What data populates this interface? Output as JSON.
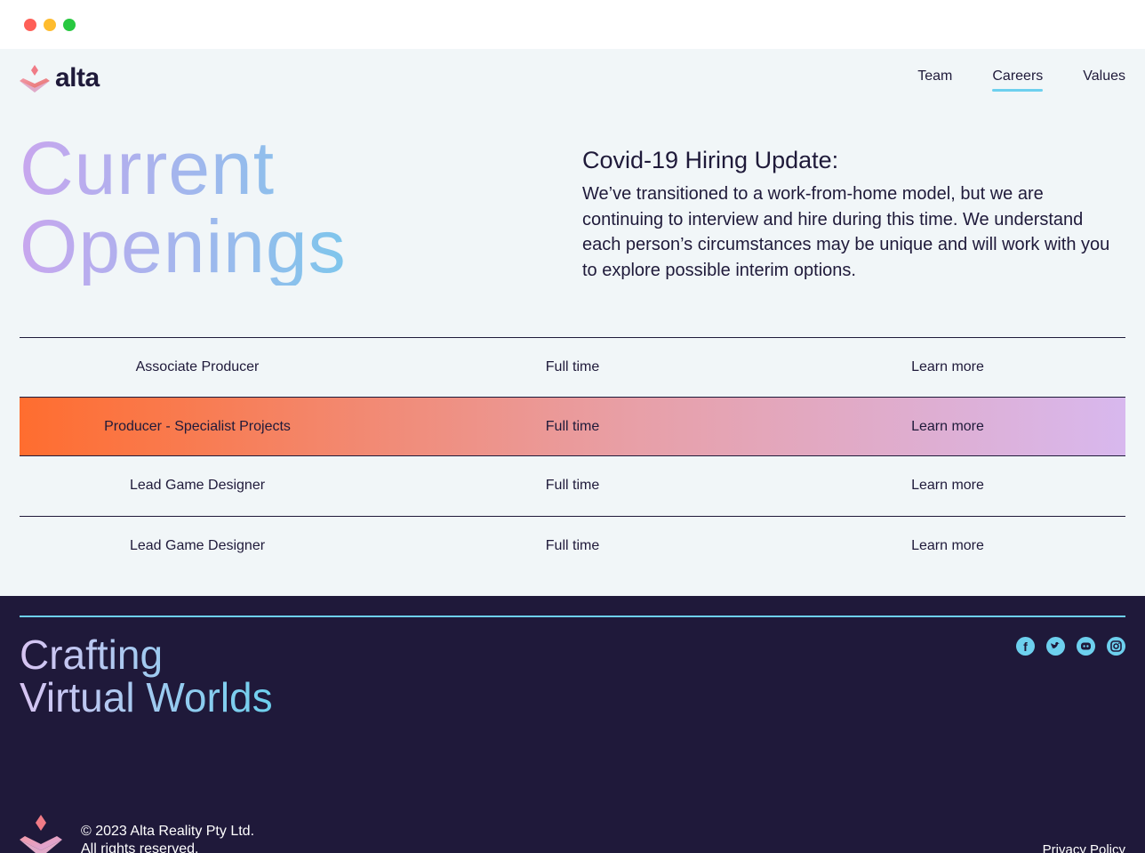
{
  "brand": {
    "name": "alta",
    "accent": "#6dd0ee",
    "dark": "#1f193a"
  },
  "nav": {
    "items": [
      {
        "label": "Team"
      },
      {
        "label": "Careers"
      },
      {
        "label": "Values"
      }
    ],
    "active": "Careers"
  },
  "hero": {
    "title_line1": "Current",
    "title_line2": "Openings"
  },
  "covid": {
    "heading": "Covid-19 Hiring Update:",
    "body": "We’ve transitioned to a work-from-home model, but we are continuing to interview and hire during this time. We understand each person’s circumstances may be unique and will work with you to explore possible interim options."
  },
  "openings": [
    {
      "title": "Associate Producer",
      "type": "Full time",
      "link": "Learn more"
    },
    {
      "title": "Producer - Specialist Projects",
      "type": "Full time",
      "link": "Learn more"
    },
    {
      "title": "Lead Game Designer",
      "type": "Full time",
      "link": "Learn more"
    },
    {
      "title": "Lead Game Designer",
      "type": "Full time",
      "link": "Learn more"
    }
  ],
  "footer": {
    "title_line1": "Crafting",
    "title_line2": "Virtual Worlds",
    "social": [
      "facebook-icon",
      "twitter-icon",
      "discord-icon",
      "instagram-icon"
    ],
    "copyright_line1": "© 2023 Alta Reality Pty Ltd.",
    "copyright_line2": "All rights reserved.",
    "privacy": "Privacy Policy"
  }
}
